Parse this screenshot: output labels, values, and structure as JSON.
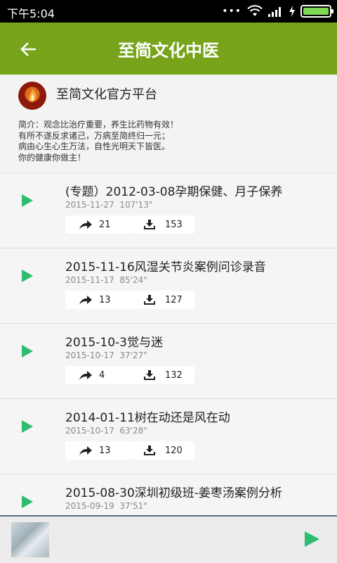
{
  "status_bar": {
    "time": "下午5:04"
  },
  "app_bar": {
    "title": "至简文化中医"
  },
  "channel": {
    "name": "至简文化官方平台",
    "description": [
      "简介：观念比治疗重要，养生比药物有效！",
      "有所不遂反求诸己，万病至简终归一元；",
      "病由心生心生万法，自性光明天下皆医。",
      "你的健康你做主！"
    ]
  },
  "items": [
    {
      "title": "(专题）2012-03-08孕期保健、月子保养",
      "date": "2015-11-27",
      "duration": "107'13\"",
      "shares": "21",
      "downloads": "153"
    },
    {
      "title": "2015-11-16风湿关节炎案例问诊录音",
      "date": "2015-11-17",
      "duration": "85'24\"",
      "shares": "13",
      "downloads": "127"
    },
    {
      "title": "2015-10-3觉与迷",
      "date": "2015-10-17",
      "duration": "37'27\"",
      "shares": "4",
      "downloads": "132"
    },
    {
      "title": "2014-01-11树在动还是风在动",
      "date": "2015-10-17",
      "duration": "63'28\"",
      "shares": "13",
      "downloads": "120"
    },
    {
      "title": "2015-08-30深圳初级班-姜枣汤案例分析",
      "date": "2015-09-19",
      "duration": "37'51\"",
      "shares": "",
      "downloads": ""
    }
  ],
  "colors": {
    "app_bar": "#77a41b",
    "play_accent": "#2ebc6e",
    "status_bar": "#000000"
  }
}
